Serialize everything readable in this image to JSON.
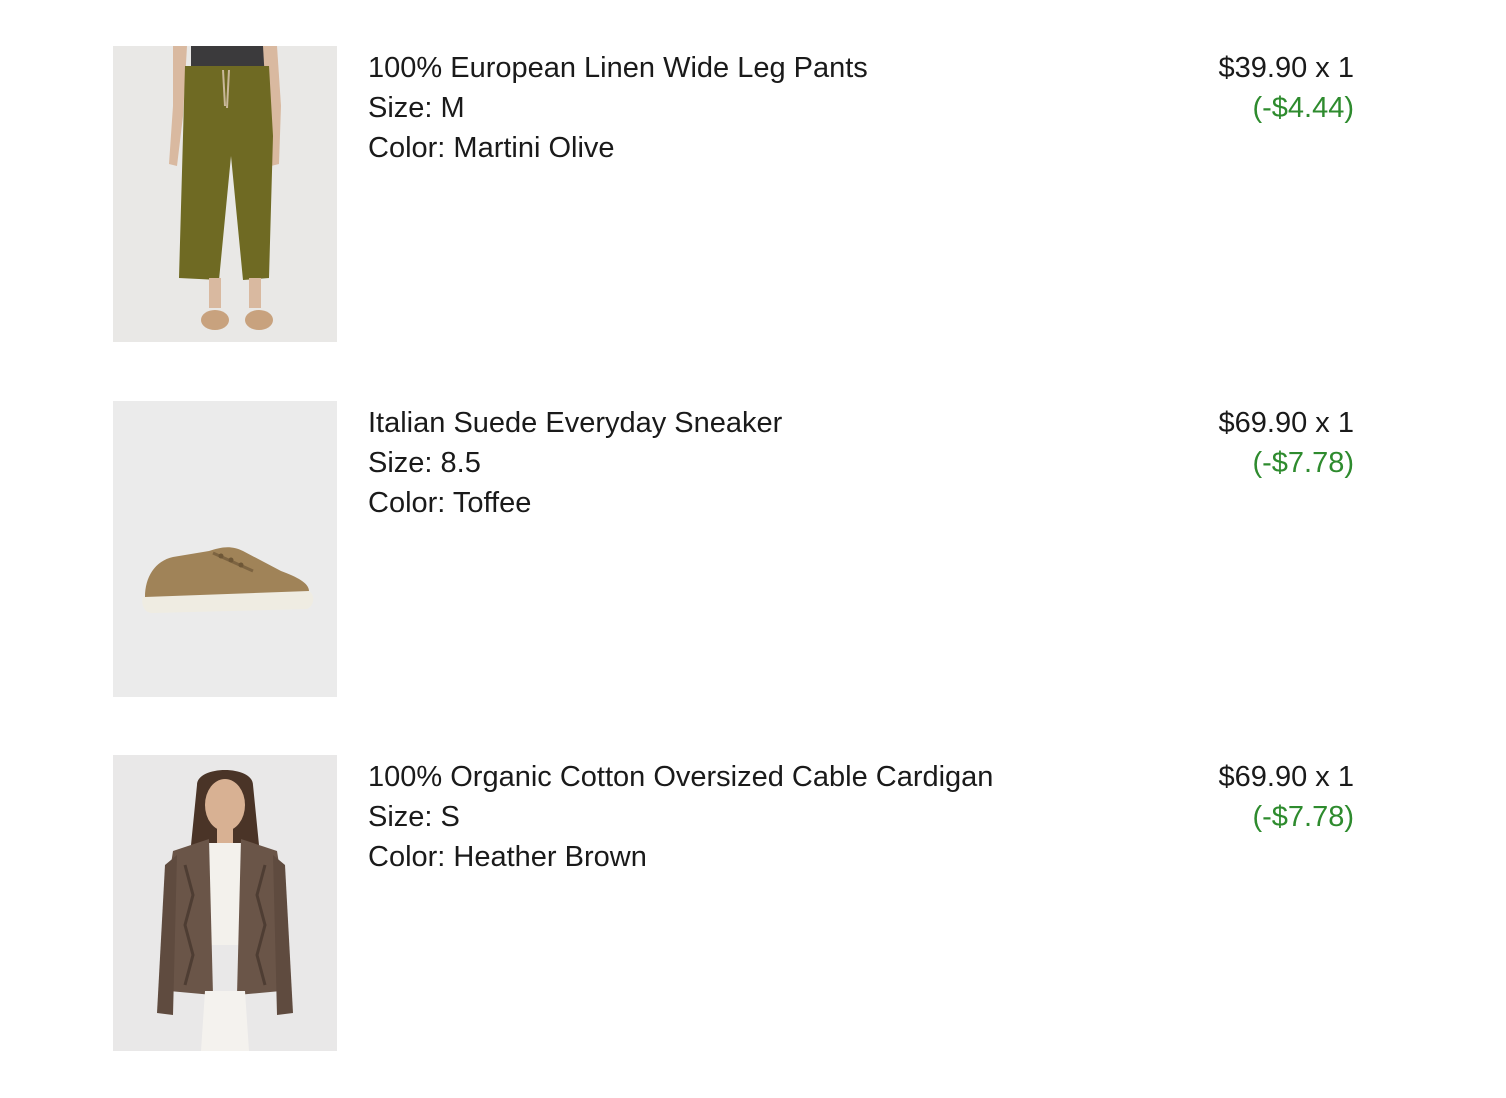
{
  "items": [
    {
      "name": "100% European Linen Wide Leg Pants",
      "size": "Size: M",
      "color": "Color: Martini Olive",
      "price_qty": "$39.90 x 1",
      "discount": "(-$4.44)"
    },
    {
      "name": "Italian Suede Everyday Sneaker",
      "size": "Size: 8.5",
      "color": "Color: Toffee",
      "price_qty": "$69.90 x 1",
      "discount": "(-$7.78)"
    },
    {
      "name": "100% Organic Cotton Oversized Cable Cardigan",
      "size": "Size: S",
      "color": "Color: Heather Brown",
      "price_qty": "$69.90 x 1",
      "discount": "(-$7.78)"
    }
  ],
  "colors": {
    "text": "#1a1a1a",
    "discount": "#2e8b2e",
    "image_background": "#ebebeb"
  }
}
